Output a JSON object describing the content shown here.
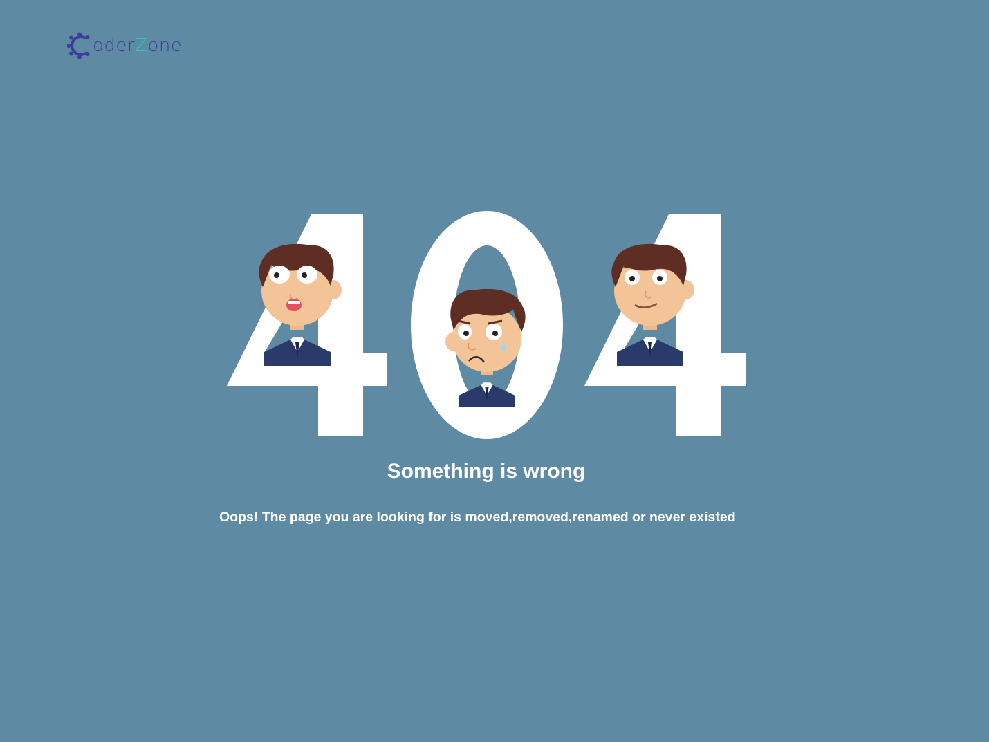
{
  "brand": {
    "name_part_1": "oder",
    "name_part_2": "Z",
    "name_part_3": "one",
    "primary_color": "#3a3f9c",
    "accent_color": "#37c2c6",
    "icon": "gear-c-icon"
  },
  "error": {
    "code": "404",
    "title": "Something is wrong",
    "message": "Oops! The page you are looking for is moved,removed,renamed or never existed"
  },
  "colors": {
    "background": "#5e8aa3",
    "text": "#ffffff"
  },
  "illustration": {
    "characters": [
      "shocked-face",
      "crying-face",
      "worried-face"
    ]
  }
}
